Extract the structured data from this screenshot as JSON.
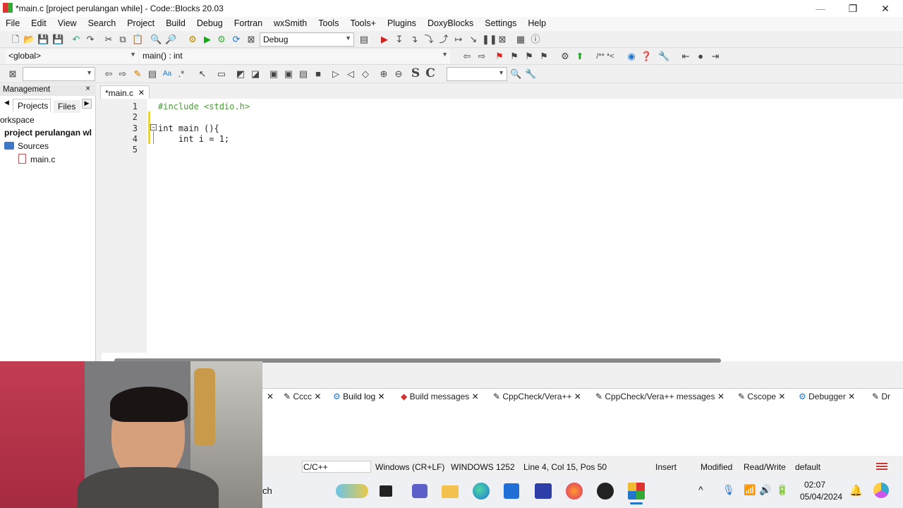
{
  "window": {
    "title": "*main.c [project perulangan while] - Code::Blocks 20.03",
    "min": "—",
    "max": "❐",
    "close": "✕"
  },
  "menu": [
    "File",
    "Edit",
    "View",
    "Search",
    "Project",
    "Build",
    "Debug",
    "Fortran",
    "wxSmith",
    "Tools",
    "Tools+",
    "Plugins",
    "DoxyBlocks",
    "Settings",
    "Help"
  ],
  "toolbar": {
    "build_target": "Debug",
    "scope": "<global>",
    "symbol": "main() : int",
    "search_value": "",
    "find_value": "",
    "s_label": "S",
    "c_label": "C",
    "doc_comment": "/** *<"
  },
  "management": {
    "title": "Management",
    "close": "×",
    "tabs": [
      "Projects",
      "Files"
    ],
    "workspace": "orkspace",
    "project": "project perulangan wl",
    "folder": "Sources",
    "file": "main.c"
  },
  "editor": {
    "tab": "*main.c",
    "tab_close": "✕",
    "lines": [
      {
        "n": "1",
        "text": "#include <stdio.h>"
      },
      {
        "n": "2",
        "text": ""
      },
      {
        "n": "3",
        "text": "int main (){"
      },
      {
        "n": "4",
        "text": "    int i = 1;"
      },
      {
        "n": "5",
        "text": ""
      }
    ]
  },
  "log_tabs": [
    "Cccc",
    "Build log",
    "Build messages",
    "CppCheck/Vera++",
    "CppCheck/Vera++ messages",
    "Cscope",
    "Debugger",
    "Dr"
  ],
  "status": {
    "language": "C/C++",
    "eol": "Windows (CR+LF)",
    "encoding": "WINDOWS 1252",
    "position": "Line 4, Col 15, Pos 50",
    "mode": "Insert",
    "modified": "Modified",
    "access": "Read/Write",
    "theme": "default"
  },
  "taskbar": {
    "search_fragment": "ch",
    "time": "02:07",
    "date": "05/04/2024"
  }
}
